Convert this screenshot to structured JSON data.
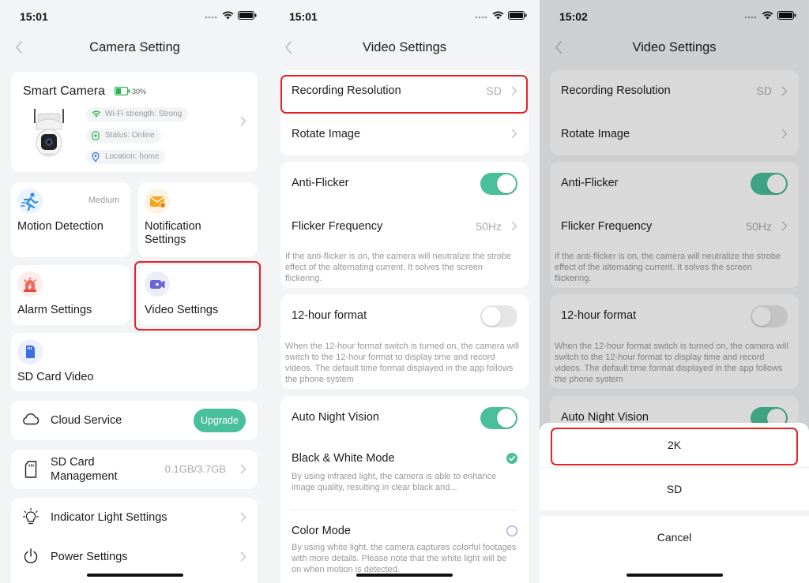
{
  "time1": "15:01",
  "time2": "15:01",
  "time3": "15:02",
  "camera_setting": {
    "title": "Camera Setting",
    "device_name": "Smart Camera",
    "battery": "30%",
    "wifi": "Wi-Fi strength: Strong",
    "status": "Status: Online",
    "location": "Location: home",
    "tiles": {
      "motion_label": "Motion Detection",
      "motion_level": "Medium",
      "notification_label": "Notification Settings",
      "alarm_label": "Alarm Settings",
      "video_label": "Video Settings",
      "sdvideo_label": "SD Card Video"
    },
    "cloud_label": "Cloud Service",
    "upgrade_label": "Upgrade",
    "sdmgmt_label": "SD Card Management",
    "sdmgmt_value": "0.1GB/3.7GB",
    "indicator_label": "Indicator Light Settings",
    "power_label": "Power Settings"
  },
  "video_settings": {
    "title": "Video Settings",
    "recording_label": "Recording Resolution",
    "recording_value": "SD",
    "rotate_label": "Rotate Image",
    "antiflicker_label": "Anti-Flicker",
    "antiflicker_on": true,
    "flicker_label": "Flicker Frequency",
    "flicker_value": "50Hz",
    "antiflicker_desc": "If the anti-flicker is on, the camera will neutralize the strobe effect of the alternating current. It solves the screen flickering.",
    "hour12_label": "12-hour format",
    "hour12_on": false,
    "hour12_desc": "When the 12-hour format switch is turned on, the camera will switch to the 12-hour format to display time and record videos. The default time format displayed in the app follows the phone system",
    "nightvision_label": "Auto Night Vision",
    "nightvision_on": true,
    "bw_label": "Black & White Mode",
    "bw_desc": "By using infrared light, the camera is able to enhance image quality, resulting in clear black and...",
    "color_label": "Color Mode",
    "color_desc": "By using white light, the camera captures colorful footages with more details. Please note that the white light will be on when motion is detected."
  },
  "sheet": {
    "option1": "2K",
    "option2": "SD",
    "cancel": "Cancel"
  },
  "colors": {
    "accent": "#49c09b",
    "highlight": "#e22426"
  }
}
